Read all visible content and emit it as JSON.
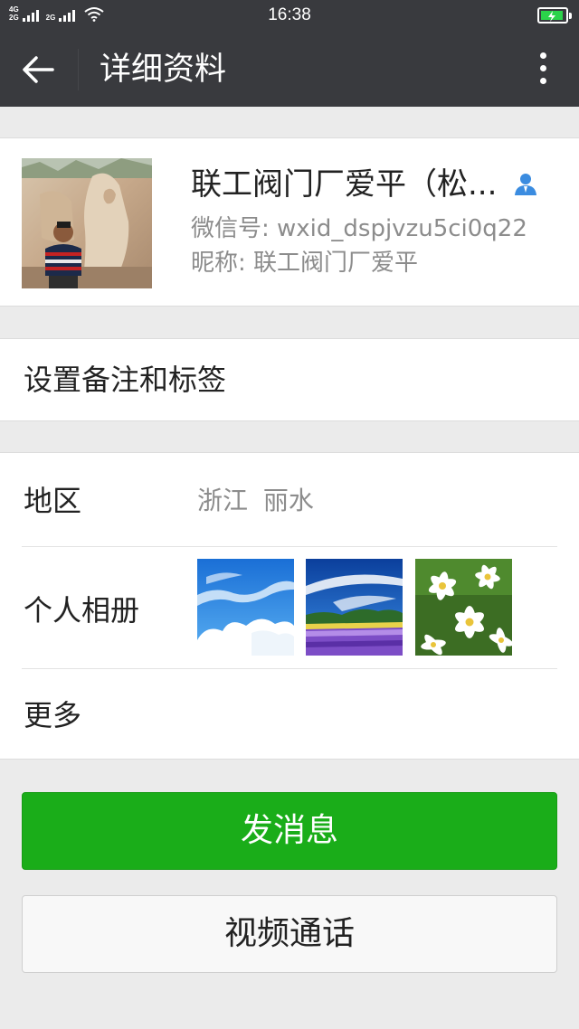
{
  "status_bar": {
    "network_1": "4G",
    "network_2": "2G",
    "network_3": "2G",
    "time": "16:38"
  },
  "nav": {
    "title": "详细资料"
  },
  "profile": {
    "name": "联工阀门厂爱平（松...",
    "wxid_label": "微信号: wxid_dspjvzu5ci0q22",
    "nickname_label": "昵称: 联工阀门厂爱平"
  },
  "remark": {
    "label": "设置备注和标签"
  },
  "details": {
    "region_label": "地区",
    "region_value": "浙江  丽水",
    "album_label": "个人相册",
    "more_label": "更多"
  },
  "actions": {
    "send_message": "发消息",
    "video_call": "视频通话"
  },
  "colors": {
    "header_bg": "#393a3e",
    "primary_green": "#1aad19",
    "page_bg": "#ebebeb",
    "secondary_text": "#8c8c8c"
  },
  "icons": [
    "back-arrow-icon",
    "more-vertical-icon",
    "contact-person-icon",
    "wifi-icon",
    "battery-charging-icon"
  ]
}
